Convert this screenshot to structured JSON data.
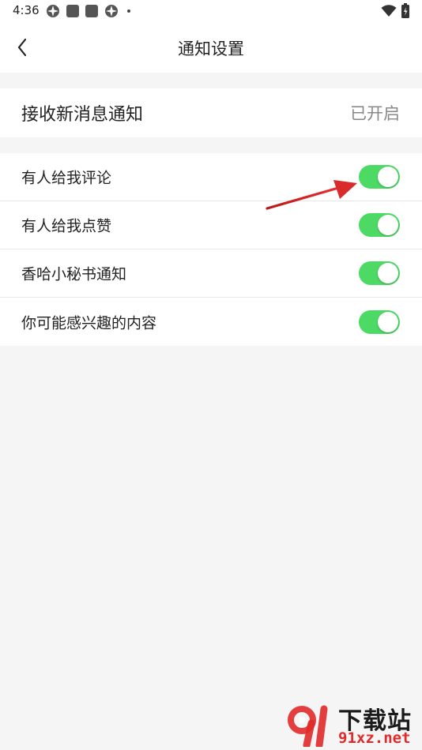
{
  "status_bar": {
    "time": "4:36"
  },
  "nav": {
    "title": "通知设置"
  },
  "master": {
    "label": "接收新消息通知",
    "status": "已开启"
  },
  "settings": [
    {
      "label": "有人给我评论",
      "enabled": true
    },
    {
      "label": "有人给我点赞",
      "enabled": true
    },
    {
      "label": "香哈小秘书通知",
      "enabled": true
    },
    {
      "label": "你可能感兴趣的内容",
      "enabled": true
    }
  ],
  "watermark": {
    "title": "下载站",
    "url": "91xz.net"
  },
  "colors": {
    "toggle_on": "#4cd964",
    "annotation_arrow": "#d92b2b",
    "watermark_red": "#e12b2b"
  }
}
